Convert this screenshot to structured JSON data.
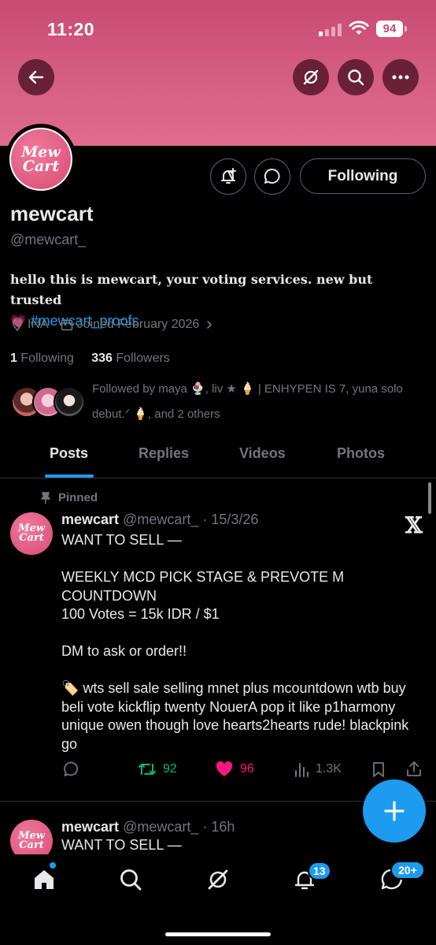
{
  "status_bar": {
    "time": "11:20",
    "battery": "94"
  },
  "profile": {
    "display_name": "mewcart",
    "handle": "@mewcart_",
    "avatar_logo_line1": "Mew",
    "avatar_logo_line2": "Cart",
    "bio_text": "hello this is mewcart, your voting services. new but trusted",
    "bio_emoji": "💗",
    "bio_hashtag": "#mewcart_proofs",
    "location": "INA",
    "joined": "Joined February 2026",
    "following_count": "1",
    "following_label": "Following",
    "followers_count": "336",
    "followers_label": "Followers",
    "followed_by": "Followed by maya 🍨, liv ★ 🍦 | ENHYPEN IS 7, yuna solo debut.ᐟ 🍦, and 2 others"
  },
  "buttons": {
    "following": "Following"
  },
  "tabs": [
    {
      "label": "Posts",
      "active": true
    },
    {
      "label": "Replies",
      "active": false
    },
    {
      "label": "Videos",
      "active": false
    },
    {
      "label": "Photos",
      "active": false
    }
  ],
  "posts": [
    {
      "pinned_label": "Pinned",
      "name": "mewcart",
      "handle_date": "@mewcart_ · 15/3/26",
      "text": "WANT TO SELL —\n\nWEEKLY MCD PICK STAGE & PREVOTE M COUNTDOWN\n100 Votes = 15k IDR / $1\n\nDM to ask or order!!\n\n🏷️ wts sell sale selling mnet plus mcountdown wtb buy beli vote kickflip twenty NouerA pop it like p1harmony unique owen though love hearts2hearts rude! blackpink go",
      "reposts": "92",
      "likes": "96",
      "views": "1.3K"
    },
    {
      "name": "mewcart",
      "handle_date": "@mewcart_ · 16h",
      "text": "WANT TO SELL —"
    }
  ],
  "nav": {
    "notifications_badge": "13",
    "messages_badge": "20+"
  },
  "colors": {
    "accent": "#1d9bf0",
    "banner": "#d65e84",
    "repost": "#00ba7c",
    "like": "#f91880"
  }
}
